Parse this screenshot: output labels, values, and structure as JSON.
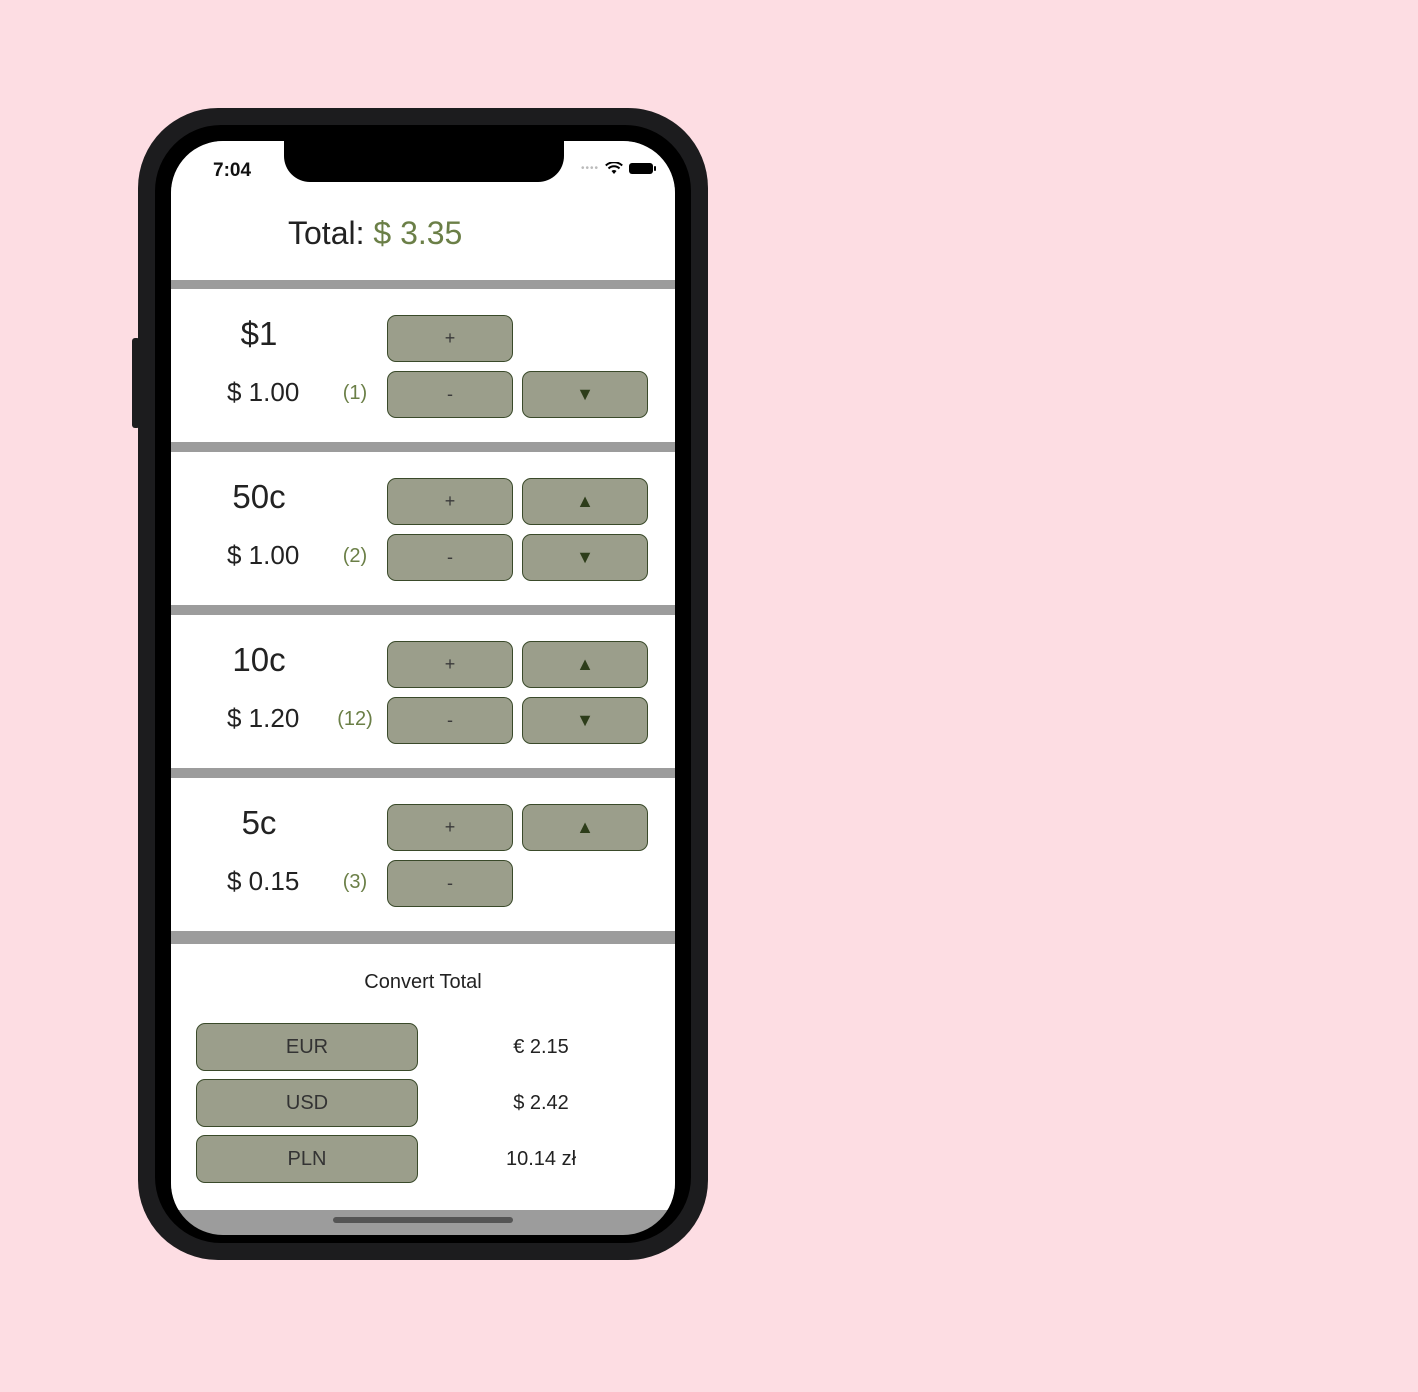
{
  "status": {
    "time": "7:04"
  },
  "header": {
    "total_label": "Total:",
    "total_value": "$ 3.35"
  },
  "rows": [
    {
      "denomination": "$1",
      "subtotal": "$ 1.00",
      "count": "(1)",
      "plus": "+",
      "minus": "-",
      "down": "▼"
    },
    {
      "denomination": "50c",
      "subtotal": "$ 1.00",
      "count": "(2)",
      "plus": "+",
      "minus": "-",
      "up": "▲",
      "down": "▼"
    },
    {
      "denomination": "10c",
      "subtotal": "$ 1.20",
      "count": "(12)",
      "plus": "+",
      "minus": "-",
      "up": "▲",
      "down": "▼"
    },
    {
      "denomination": "5c",
      "subtotal": "$ 0.15",
      "count": "(3)",
      "plus": "+",
      "minus": "-",
      "up": "▲"
    }
  ],
  "convert": {
    "title": "Convert Total",
    "currencies": [
      {
        "code": "EUR",
        "value": "€ 2.15"
      },
      {
        "code": "USD",
        "value": "$ 2.42"
      },
      {
        "code": "PLN",
        "value": "10.14 zł"
      }
    ]
  },
  "colors": {
    "accent": "#6b7f47",
    "button": "#9b9e8b",
    "background": "#fddde3"
  }
}
